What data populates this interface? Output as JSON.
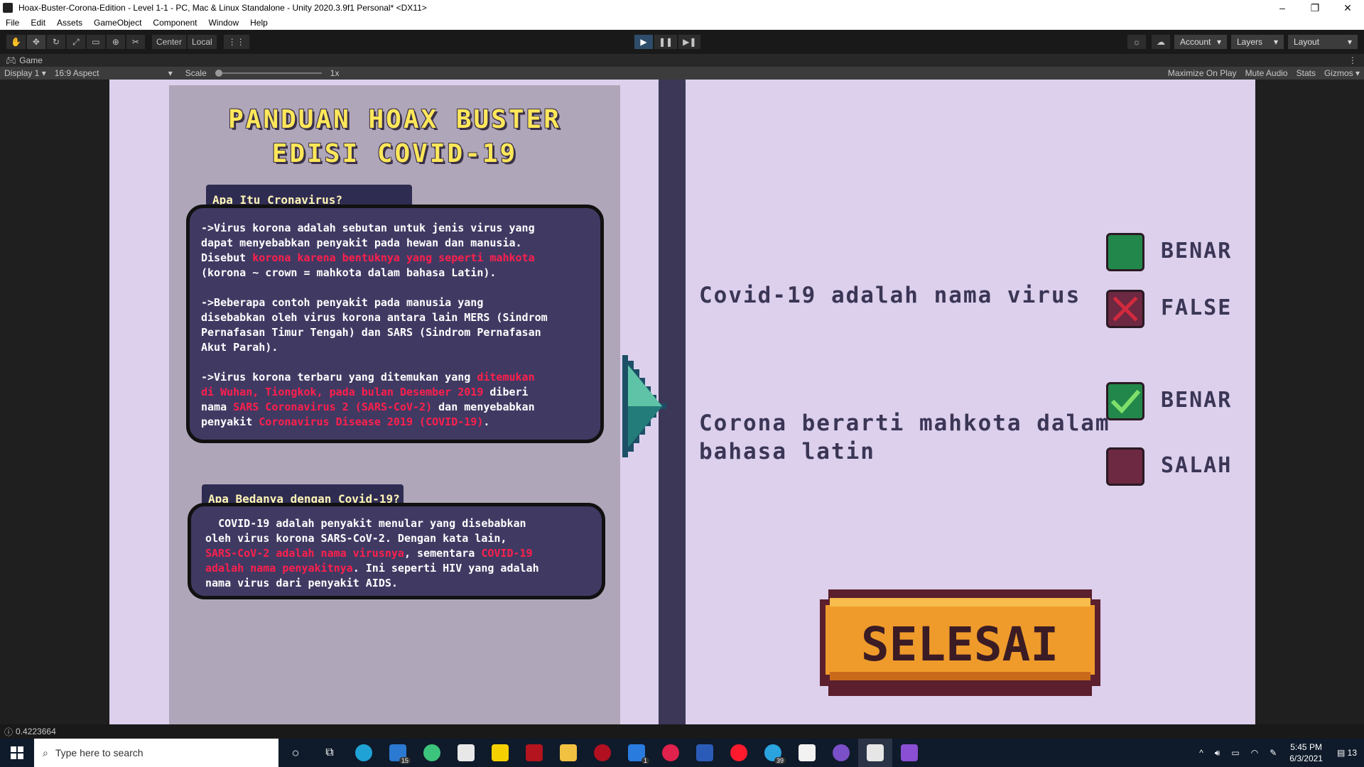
{
  "window": {
    "title": "Hoax-Buster-Corona-Edition - Level 1-1 - PC, Mac & Linux Standalone - Unity 2020.3.9f1 Personal* <DX11>",
    "minimize": "–",
    "restore": "❐",
    "close": "✕"
  },
  "menu": [
    "File",
    "Edit",
    "Assets",
    "GameObject",
    "Component",
    "Window",
    "Help"
  ],
  "toolbar": {
    "tools": [
      "hand-tool",
      "move-tool",
      "rotate-tool",
      "scale-tool",
      "rect-tool",
      "transform-tool",
      "custom-tool"
    ],
    "pivot": "Center",
    "space": "Local",
    "play": "▶",
    "pause": "❚❚",
    "step": "▶❚",
    "account": "Account",
    "layers": "Layers",
    "layout": "Layout"
  },
  "game_tab": {
    "label": "Game",
    "display": "Display 1",
    "aspect": "16:9 Aspect",
    "scale_label": "Scale",
    "scale_value": "1x",
    "maximize": "Maximize On Play",
    "mute": "Mute Audio",
    "stats": "Stats",
    "gizmos": "Gizmos"
  },
  "guide": {
    "title_line1": "PANDUAN HOAX BUSTER",
    "title_line2": "EDISI COVID-19",
    "section1_label": "Apa Itu Cronavirus?",
    "section1": {
      "p1a": "->Virus korona adalah sebutan untuk jenis virus yang\ndapat menyebabkan penyakit pada hewan dan manusia.\nDisebut ",
      "p1red": "korona karena bentuknya yang seperti mahkota",
      "p1b": "\n(korona ~ crown = mahkota dalam bahasa Latin).\n\n->Beberapa contoh penyakit pada manusia yang\ndisebabkan oleh virus korona antara lain MERS (Sindrom\nPernafasan Timur Tengah) dan SARS (Sindrom Pernafasan\nAkut Parah).\n\n->Virus korona terbaru yang ditemukan yang ",
      "p3red1": "ditemukan\ndi Wuhan, Tiongkok, pada bulan Desember 2019",
      "p3b": " diberi\nnama ",
      "p3red2": "SARS Coronavirus 2 (SARS-CoV-2)",
      "p3c": " dan menyebabkan\npenyakit ",
      "p3red3": "Coronavirus Disease 2019 (COVID-19)",
      "p3d": "."
    },
    "section2_label": "Apa Bedanya dengan Covid-19?",
    "section2": {
      "a": "  COVID-19 adalah penyakit menular yang disebabkan\noleh virus korona SARS-CoV-2. Dengan kata lain,\n",
      "red1": "SARS-CoV-2 adalah nama virusnya",
      "b": ", sementara ",
      "red2": "COVID-19\nadalah nama penyakitnya",
      "c": ". Ini seperti HIV yang adalah\nnama virus dari penyakit AIDS."
    }
  },
  "quiz": {
    "q1": "Covid-19 adalah nama virus",
    "q1_true": "BENAR",
    "q1_false": "FALSE",
    "q2_line1": "Corona berarti mahkota dalam",
    "q2_line2": "bahasa latin",
    "q2_true": "BENAR",
    "q2_false": "SALAH",
    "finish": "SELESAI",
    "colors": {
      "true": "#22874a",
      "false": "#6d2842",
      "check": "#7ee06b",
      "cross": "#d22a3d"
    }
  },
  "status": {
    "value": "0.4223664"
  },
  "taskbar": {
    "search_placeholder": "Type here to search",
    "badge_mail": "15",
    "badge_todo": "1",
    "badge_telegram": "39",
    "time": "5:45 PM",
    "date": "6/3/2021",
    "notifications": "13"
  }
}
